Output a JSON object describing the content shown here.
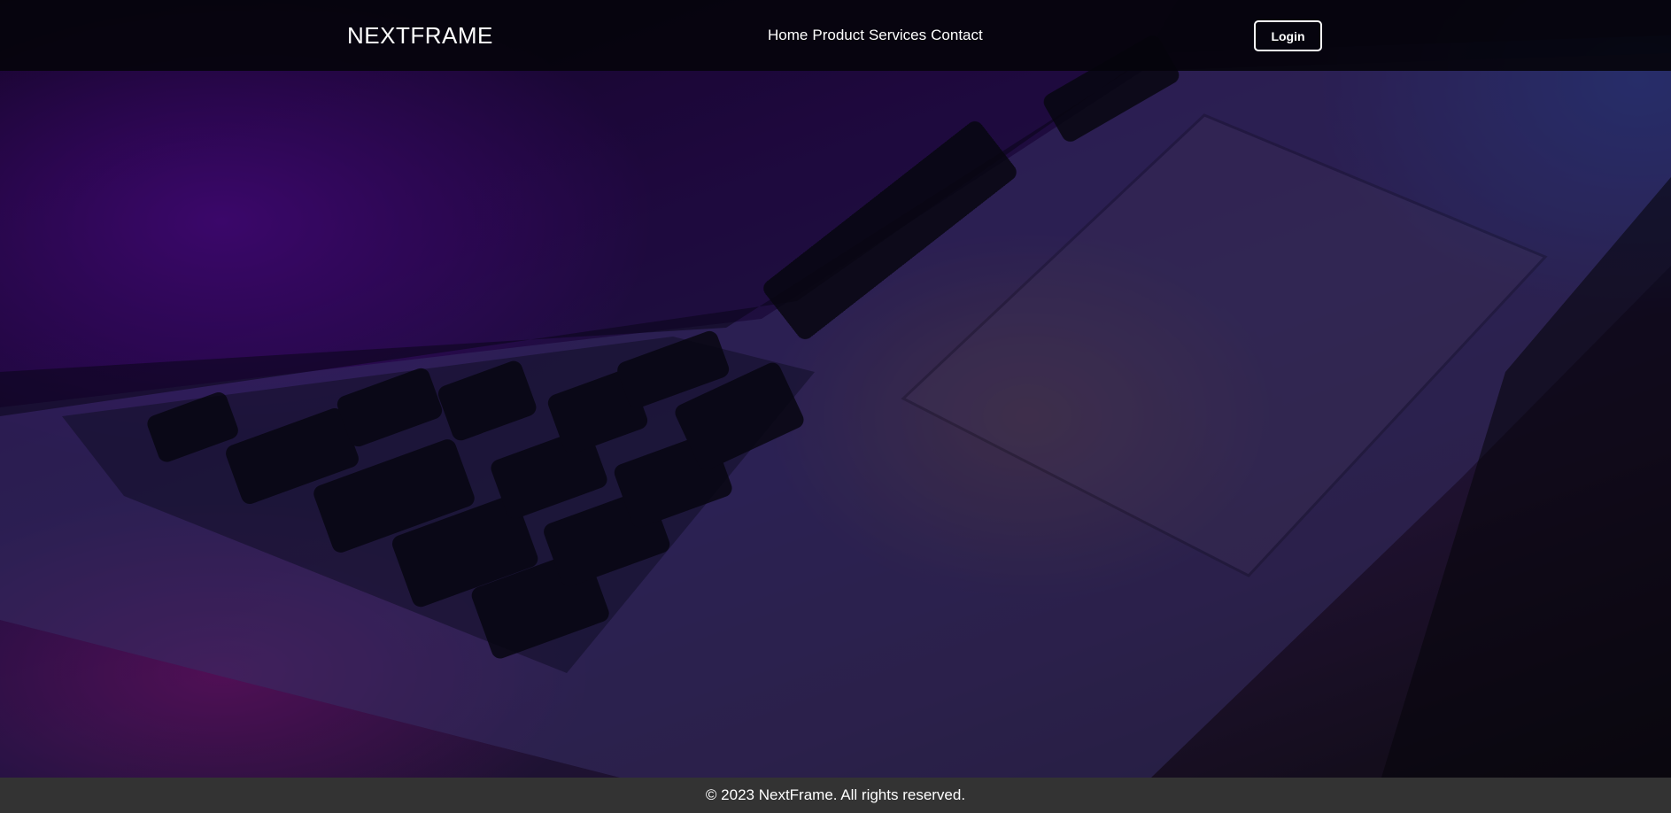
{
  "header": {
    "logo_text": "NEXTFRAME",
    "nav": [
      {
        "label": "Home"
      },
      {
        "label": "Product"
      },
      {
        "label": "Services"
      },
      {
        "label": "Contact"
      }
    ],
    "login_label": "Login"
  },
  "hero": {
    "background": "laptop keyboard and trackpad, purple and blue lighting"
  },
  "footer": {
    "copyright": "© 2023 NextFrame. All rights reserved."
  },
  "colors": {
    "header_bg": "#05040c",
    "footer_bg": "#333333",
    "text": "#ffffff",
    "hero_purple": "#2a0c55",
    "hero_blue": "#1c46aa",
    "hero_orange": "#6e4632"
  }
}
